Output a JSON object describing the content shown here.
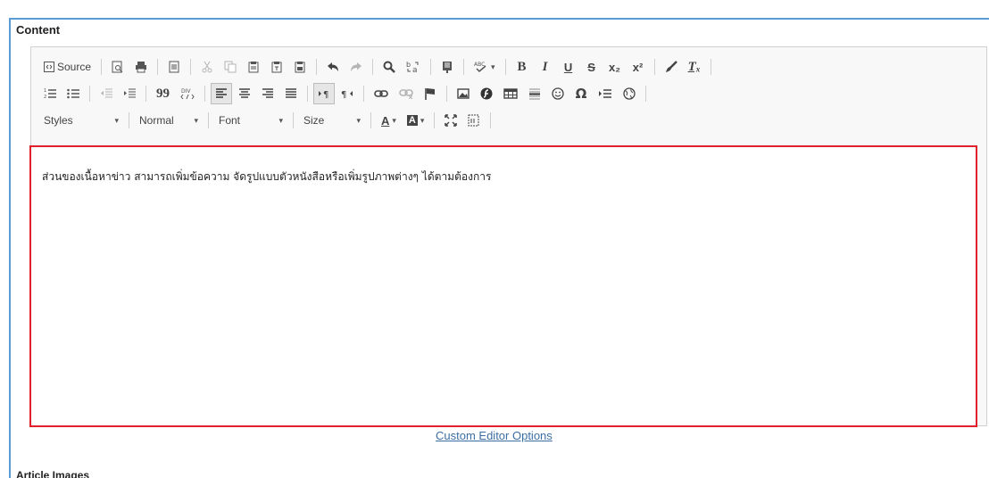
{
  "section": {
    "title": "Content"
  },
  "toolbar": {
    "source_label": "Source",
    "styles_label": "Styles",
    "format_label": "Normal",
    "font_label": "Font",
    "size_label": "Size",
    "bold": "B",
    "italic": "I",
    "underline": "U",
    "strike": "S",
    "omega": "Ω",
    "quote": "99",
    "text_color": "A",
    "bg_color": "A",
    "subscript": "x₂",
    "superscript": "x²",
    "remove_format": "Tₓ"
  },
  "editor": {
    "text": "ส่วนของเนื้อหาข่าว สามารถเพิ่มข้อความ จัดรูปแบบตัวหนังสือหรือเพิ่มรูปภาพต่างๆ ได้ตามต้องการ"
  },
  "custom_options_link": "Custom Editor Options",
  "next_section": {
    "title": "Article Images"
  },
  "colors": {
    "accent": "#5b9bd5",
    "highlight_border": "#e0202a",
    "link": "#3a6ea5"
  }
}
